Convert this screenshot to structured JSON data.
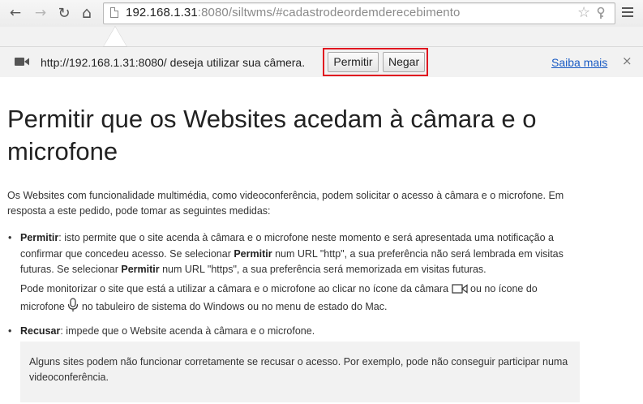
{
  "browser": {
    "url_host": "192.168.1.31",
    "url_rest": ":8080/siltwms/#cadastrodeordemderecebimento",
    "back_icon": "←",
    "forward_icon": "→",
    "reload_icon": "↻",
    "home_icon": "⌂",
    "star_icon": "☆"
  },
  "infobar": {
    "message": "http://192.168.1.31:8080/ deseja utilizar sua câmera.",
    "allow_label": "Permitir",
    "deny_label": "Negar",
    "learn_more": "Saiba mais",
    "close_icon": "×",
    "highlight_color": "#e0151f"
  },
  "article": {
    "title": "Permitir que os Websites acedam à câmara e o microfone",
    "intro": "Os Websites com funcionalidade multimédia, como videoconferência, podem solicitar o acesso à câmara e o microfone. Em resposta a este pedido, pode tomar as seguintes medidas:",
    "bullet_mark": "•",
    "allow_term": "Permitir",
    "allow_text_1": ": isto permite que o site acenda à câmara e o microfone  neste  momento e será apresentada uma notificação a confirmar que concedeu acesso. Se selecionar ",
    "allow_term_2": "Permitir",
    "allow_text_2": " num URL \"http\", a sua preferência não será lembrada em visitas futuras. Se selecionar ",
    "allow_term_3": "Permitir",
    "allow_text_3": " num URL \"https\", a sua preferência será memorizada em visitas futuras.",
    "monitor_text_1": "Pode monitorizar o site que está a utilizar a câmara e o microfone ao clicar no ícone da câmara",
    "monitor_text_2": "ou no ícone do microfone",
    "monitor_text_3": "no tabuleiro de sistema do Windows ou no menu de estado do Mac.",
    "refuse_term": "Recusar",
    "refuse_text": ": impede que o Website acenda à câmara e o microfone.",
    "note": "Alguns sites podem não funcionar corretamente se recusar o acesso. Por exemplo, pode não conseguir participar numa videoconferência."
  }
}
